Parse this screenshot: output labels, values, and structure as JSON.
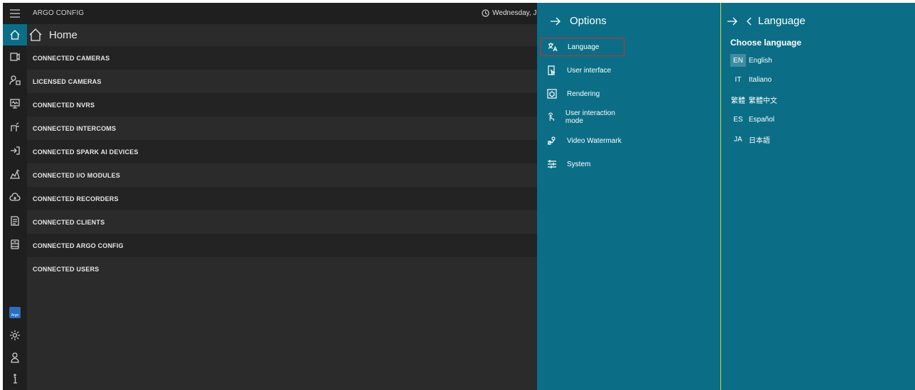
{
  "app": {
    "title": "ARGO CONFIG",
    "clock_text": "Wednesday, July"
  },
  "home": {
    "title": "Home"
  },
  "sections": [
    "CONNECTED CAMERAS",
    "LICENSED CAMERAS",
    "CONNECTED NVRS",
    "CONNECTED INTERCOMS",
    "CONNECTED SPARK AI DEVICES",
    "CONNECTED I/O MODULES",
    "CONNECTED RECORDERS",
    "CONNECTED CLIENTS",
    "CONNECTED ARGO CONFIG",
    "CONNECTED USERS"
  ],
  "rail": {
    "icons": [
      "menu-icon",
      "home-icon",
      "camera-icon",
      "licensed-cameras-icon",
      "nvr-icon",
      "intercom-icon",
      "spark-ai-icon",
      "io-modules-icon",
      "recorders-icon",
      "clients-icon",
      "argo-config-icon",
      "argo-logo",
      "settings-icon",
      "user-icon",
      "info-icon"
    ],
    "argo_badge_text": "Argo"
  },
  "options": {
    "title": "Options",
    "items": [
      {
        "label": "Language",
        "icon": "language-icon",
        "selected": true
      },
      {
        "label": "User interface",
        "icon": "user-interface-icon"
      },
      {
        "label": "Rendering",
        "icon": "rendering-icon"
      },
      {
        "label": "User interaction mode",
        "icon": "touch-icon"
      },
      {
        "label": "Video Watermark",
        "icon": "watermark-icon"
      },
      {
        "label": "System",
        "icon": "system-icon"
      }
    ]
  },
  "language": {
    "title": "Language",
    "choose_label": "Choose language",
    "items": [
      {
        "code": "EN",
        "name": "English",
        "active": true
      },
      {
        "code": "IT",
        "name": "Italiano"
      },
      {
        "code": "繁體",
        "name": "繁體中文"
      },
      {
        "code": "ES",
        "name": "Español"
      },
      {
        "code": "JA",
        "name": "日本語"
      }
    ]
  },
  "colors": {
    "panel_teal": "#0b6e86",
    "selection_red": "#d42b2b",
    "divider_yellow": "#c8d94a",
    "dark_bg": "#2b2b2b"
  }
}
